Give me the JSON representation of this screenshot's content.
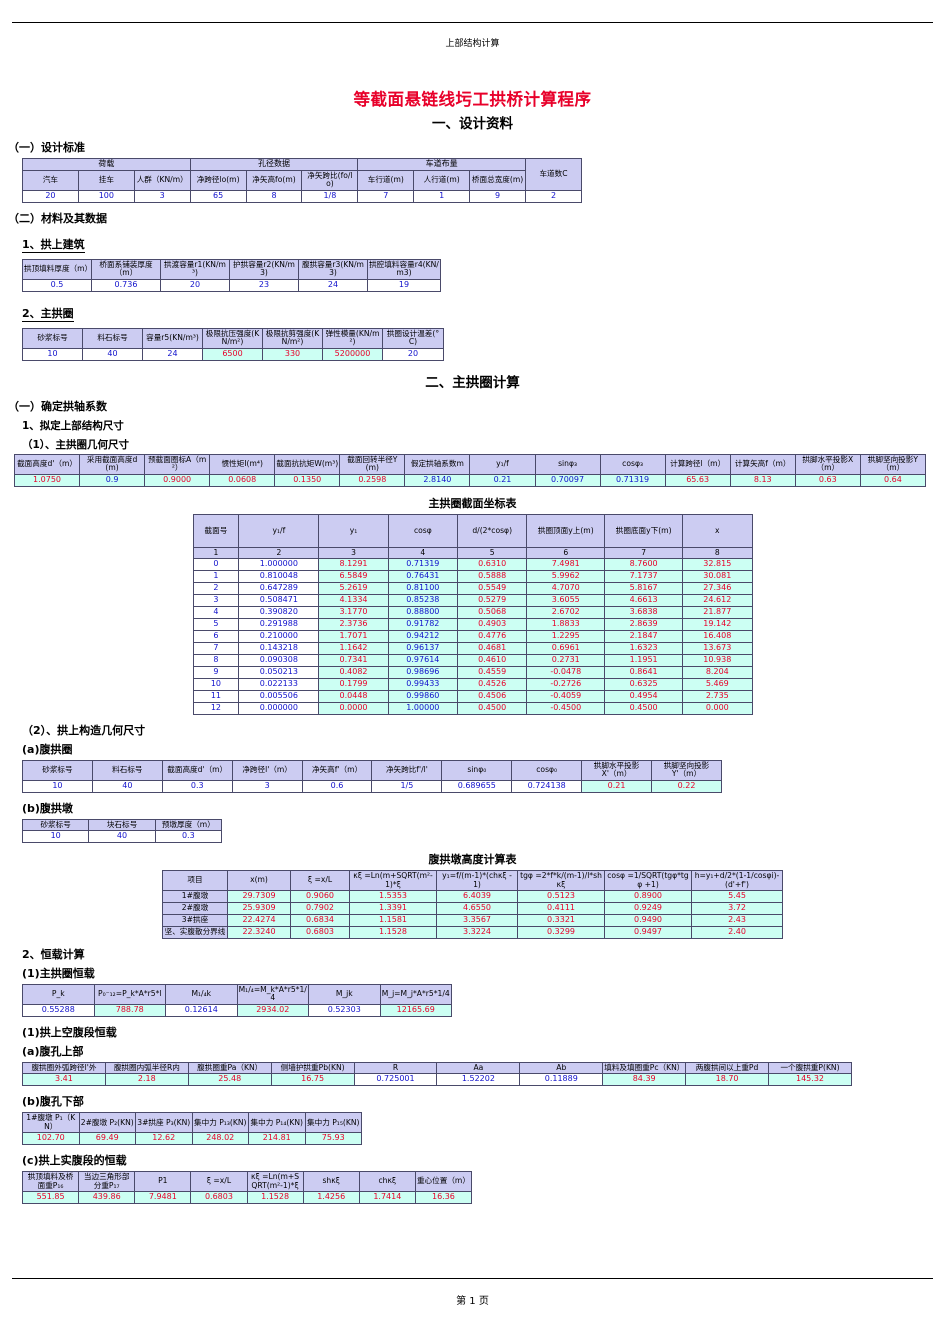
{
  "header": {
    "text": "上部结构计算"
  },
  "footer": {
    "text": "第 1 页"
  },
  "title": "等截面悬链线圬工拱桥计算程序",
  "section1": {
    "bar": "一、设计资料"
  },
  "design_std": {
    "heading": "（一）设计标准",
    "group_headers": [
      "荷载",
      "孔径数据",
      "车道布量"
    ],
    "columns": [
      "汽车",
      "挂车",
      "人群（KN/m）",
      "净跨径lo(m)",
      "净矢高fo(m)",
      "净矢跨比(fo/lo)",
      "车行道(m)",
      "人行道(m)",
      "桥面总宽度(m)",
      "车道数C"
    ],
    "values": [
      "20",
      "100",
      "3",
      "65",
      "8",
      "1/8",
      "7",
      "1",
      "9",
      "2"
    ]
  },
  "materials": {
    "heading": "（二）材料及其数据",
    "sub1": "1、拱上建筑",
    "arch_super": {
      "columns": [
        "拱顶填料厚度（m）",
        "桥面系铺装厚度（m）",
        "拱渡容量r1(KN/m³)",
        "护拱容量r2(KN/m3)",
        "腹拱容量r3(KN/m3)",
        "拱腔填料容量r4(KN/m3)"
      ],
      "values": [
        "0.5",
        "0.736",
        "20",
        "23",
        "24",
        "19"
      ]
    },
    "sub2": "2、主拱圈",
    "main_ring": {
      "columns": [
        "砂浆标号",
        "料石标号",
        "容量r5(KN/m³)",
        "极限抗压强度(KN/m²)",
        "极限抗剪强度(KN/m²)",
        "弹性模量(KN/m²)",
        "拱圈设计温差(°C)"
      ],
      "values": [
        "10",
        "40",
        "24",
        "6500",
        "330",
        "5200000",
        "20"
      ],
      "calc_flags": [
        false,
        false,
        false,
        true,
        true,
        true,
        false
      ]
    }
  },
  "section2": {
    "bar": "二、主拱圈计算"
  },
  "arch_coef": {
    "heading": "（一）确定拱轴系数",
    "sub1": "1、拟定上部结构尺寸",
    "sub2": "（1）、主拱圈几何尺寸",
    "columns": [
      "截面高度d'（m）",
      "采用截面高度d(m)",
      "预截面圈标A（m²）",
      "惯性矩I(m⁴)",
      "截面抗抗矩W(m³)",
      "截面回转半径Υ(m)",
      "假定拱轴系数m",
      "y₁/f",
      "sinφ₃",
      "cosφ₃",
      "计算跨径l（m）",
      "计算矢高f（m）",
      "拱脚水平投影X（m）",
      "拱脚坚向投影Y（m）"
    ],
    "values": [
      "1.0750",
      "0.9",
      "0.9000",
      "0.0608",
      "0.1350",
      "0.2598",
      "2.8140",
      "0.21",
      "0.70097",
      "0.71319",
      "65.63",
      "8.13",
      "0.63",
      "0.64"
    ],
    "styles": [
      "rc",
      "bc",
      "rc",
      "rc",
      "rc",
      "rc",
      "bc",
      "bc",
      "bc",
      "bc",
      "rc",
      "rc",
      "rc",
      "rc"
    ]
  },
  "coord_table": {
    "title": "主拱圈截面坐标表",
    "columns": [
      "截面号",
      "y₁/f",
      "y₁",
      "cosφ",
      "d/(2*cosφ)",
      "拱圈顶面y上(m)",
      "拱圈底面y下(m)",
      "x"
    ],
    "index_row": [
      "1",
      "2",
      "3",
      "4",
      "5",
      "6",
      "7",
      "8"
    ],
    "rows": [
      [
        "0",
        "1.000000",
        "8.1291",
        "0.71319",
        "0.6310",
        "7.4981",
        "8.7600",
        "32.815"
      ],
      [
        "1",
        "0.810048",
        "6.5849",
        "0.76431",
        "0.5888",
        "5.9962",
        "7.1737",
        "30.081"
      ],
      [
        "2",
        "0.647289",
        "5.2619",
        "0.81100",
        "0.5549",
        "4.7070",
        "5.8167",
        "27.346"
      ],
      [
        "3",
        "0.508471",
        "4.1334",
        "0.85238",
        "0.5279",
        "3.6055",
        "4.6613",
        "24.612"
      ],
      [
        "4",
        "0.390820",
        "3.1770",
        "0.88800",
        "0.5068",
        "2.6702",
        "3.6838",
        "21.877"
      ],
      [
        "5",
        "0.291988",
        "2.3736",
        "0.91782",
        "0.4903",
        "1.8833",
        "2.8639",
        "19.142"
      ],
      [
        "6",
        "0.210000",
        "1.7071",
        "0.94212",
        "0.4776",
        "1.2295",
        "2.1847",
        "16.408"
      ],
      [
        "7",
        "0.143218",
        "1.1642",
        "0.96137",
        "0.4681",
        "0.6961",
        "1.6323",
        "13.673"
      ],
      [
        "8",
        "0.090308",
        "0.7341",
        "0.97614",
        "0.4610",
        "0.2731",
        "1.1951",
        "10.938"
      ],
      [
        "9",
        "0.050213",
        "0.4082",
        "0.98696",
        "0.4559",
        "-0.0478",
        "0.8641",
        "8.204"
      ],
      [
        "10",
        "0.022133",
        "0.1799",
        "0.99433",
        "0.4526",
        "-0.2726",
        "0.6325",
        "5.469"
      ],
      [
        "11",
        "0.005506",
        "0.0448",
        "0.99860",
        "0.4506",
        "-0.4059",
        "0.4954",
        "2.735"
      ],
      [
        "12",
        "0.000000",
        "0.0000",
        "1.00000",
        "0.4500",
        "-0.4500",
        "0.4500",
        "0.000"
      ]
    ]
  },
  "super_geo": {
    "heading": "（2）、拱上构造几何尺寸",
    "sub_a": "(a)腹拱圈",
    "a_columns": [
      "砂浆标号",
      "料石标号",
      "截面高度d'（m）",
      "净跨径l'（m）",
      "净矢高f'（m）",
      "净矢跨比f'/l'",
      "sinφ₀",
      "cosφ₀",
      "拱脚水平投影X'（m）",
      "拱脚坚向投影Y'（m）"
    ],
    "a_values": [
      "10",
      "40",
      "0.3",
      "3",
      "0.6",
      "1/5",
      "0.689655",
      "0.724138",
      "0.21",
      "0.22"
    ],
    "a_styles": [
      "b",
      "b",
      "b",
      "b",
      "b",
      "b",
      "b",
      "b",
      "rc",
      "rc"
    ],
    "sub_b": "(b)腹拱墩",
    "b_columns": [
      "砂浆标号",
      "块石标号",
      "预墩厚度（m）"
    ],
    "b_values": [
      "10",
      "40",
      "0.3"
    ]
  },
  "pier_height": {
    "title": "腹拱墩高度计算表",
    "columns": [
      "项目",
      "x(m)",
      "ξ =x/L",
      "κξ =Ln(m+SQRT(m²-1)*ξ",
      "y₁=f/(m-1)*(chκξ - 1)",
      "tgφ =2*f*k/(m-1)/l*shκξ",
      "cosφ =1/SQRT(tgφ*tgφ +1)",
      "h=y₁+d/2*(1-1/cosφi)-(d'+f')"
    ],
    "rows": [
      [
        "1#腹墩",
        "29.7309",
        "0.9060",
        "1.5353",
        "6.4039",
        "0.5123",
        "0.8900",
        "5.45"
      ],
      [
        "2#腹墩",
        "25.9309",
        "0.7902",
        "1.3391",
        "4.6550",
        "0.4111",
        "0.9249",
        "3.72"
      ],
      [
        "3#拱座",
        "22.4274",
        "0.6834",
        "1.1581",
        "3.3567",
        "0.3321",
        "0.9490",
        "2.43"
      ],
      [
        "坚、实腹散分界线",
        "22.3240",
        "0.6803",
        "1.1528",
        "3.3224",
        "0.3299",
        "0.9497",
        "2.40"
      ]
    ]
  },
  "dead_load": {
    "heading": "2、恒载计算",
    "sub1": "(1)主拱圈恒载",
    "main": {
      "columns": [
        "P_k",
        "P₀⁻₁₂=P_k*A*r5*l",
        "M₁/₄k",
        "M₁/₄=M_k*A*r5*1/4",
        "M_jk",
        "M_j=M_j*A*r5*1/4"
      ],
      "values": [
        "0.55288",
        "788.78",
        "0.12614",
        "2934.02",
        "0.52303",
        "12165.69"
      ],
      "styles": [
        "b",
        "rc",
        "b",
        "rc",
        "b",
        "rc"
      ]
    },
    "sub2": "(1)拱上空腹段恒载",
    "sub2a": "(a)腹孔上部",
    "upper": {
      "columns": [
        "腹拱圈外弧跨径l'外",
        "腹拱圈内弧半径R内",
        "腹拱圈重Pa（KN）",
        "侧墙护拱重Pb(KN)",
        "R",
        "Aa",
        "Ab",
        "填料及填圈重Pc（KN）",
        "两腹拱间以上重Pd",
        "一个腹拱重P(KN)"
      ],
      "values": [
        "3.41",
        "2.18",
        "25.48",
        "16.75",
        "0.725001",
        "1.52202",
        "0.11889",
        "84.39",
        "18.70",
        "145.32"
      ],
      "styles": [
        "rc",
        "rc",
        "rc",
        "rc",
        "b",
        "b",
        "b",
        "rc",
        "rc",
        "rc"
      ]
    },
    "sub2b": "(b)腹孔下部",
    "lower": {
      "columns": [
        "1#腹墩 P₁（KN）",
        "2#腹墩 P₂(KN)",
        "3#拱座 P₃(KN)",
        "集中力 P₁₃(KN)",
        "集中力 P₁₄(KN)",
        "集中力 P₁₅(KN)"
      ],
      "values": [
        "102.70",
        "69.49",
        "12.62",
        "248.02",
        "214.81",
        "75.93"
      ]
    },
    "sub3": "(c)拱上实腹段的恒载",
    "solid": {
      "columns": [
        "拱顶填料及桥面重P₁₆",
        "当边三角形部分重P₁₇",
        "P1",
        "ξ =x/L",
        "κξ =Ln(m+SQRT(m²-1)*ξ",
        "shκξ",
        "chκξ",
        "重心位置（m）"
      ],
      "values": [
        "551.85",
        "439.86",
        "7.9481",
        "0.6803",
        "1.1528",
        "1.4256",
        "1.7414",
        "16.36"
      ]
    }
  }
}
